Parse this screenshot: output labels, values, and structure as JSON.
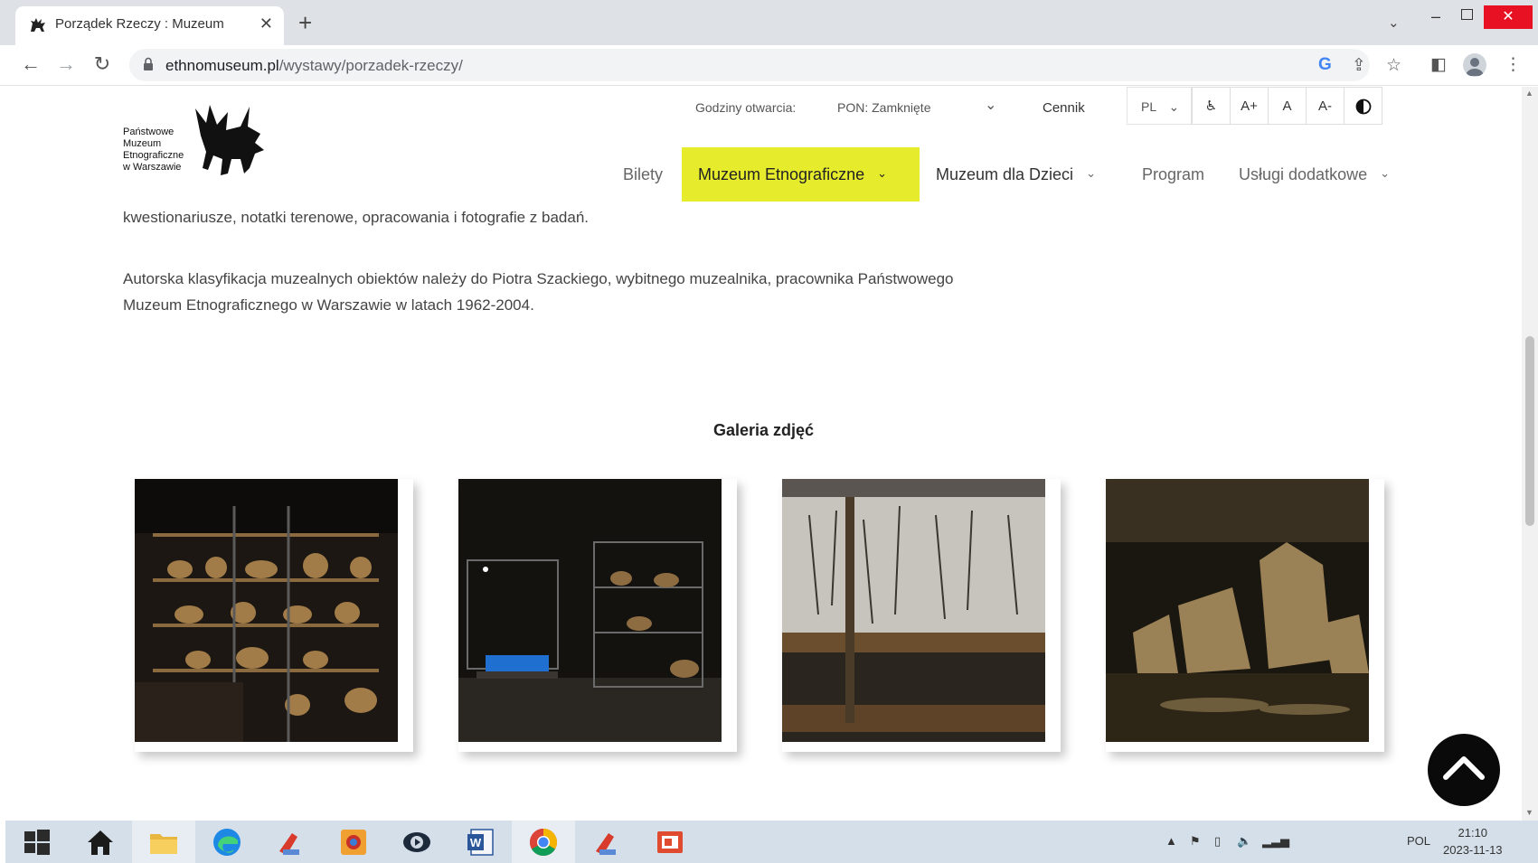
{
  "browser": {
    "tab_title": "Porządek Rzeczy : Muzeum",
    "tab_close": "✕",
    "new_tab": "+",
    "url_host": "ethnomuseum.pl",
    "url_path": "/wystawy/porzadek-rzeczy/"
  },
  "header": {
    "logo_text": [
      "Państwowe",
      "Muzeum",
      "Etnograficzne",
      "w Warszawie"
    ],
    "hours_label": "Godziny otwarcia:",
    "hours_value": "PON: Zamknięte",
    "pricing": "Cennik",
    "lang": "PL",
    "accessibility": {
      "font_increase": "A+",
      "font_normal": "A",
      "font_decrease": "A-"
    }
  },
  "nav": {
    "items": [
      {
        "label": "Bilety"
      },
      {
        "label": "Muzeum Etnograficzne"
      },
      {
        "label": "Muzeum dla Dzieci"
      },
      {
        "label": "Program"
      },
      {
        "label": "Usługi dodatkowe"
      }
    ],
    "accent_color": "#e6ec2c"
  },
  "content": {
    "para1": "kwestionariusze, notatki terenowe, opracowania i fotografie z badań.",
    "para2_line1": "Autorska klasyfikacja muzealnych obiektów należy do Piotra Szackiego, wybitnego muzealnika, pracownika Państwowego",
    "para2_line2": "Muzeum Etnograficznego w Warszawie w latach 1962-2004.",
    "gallery_title": "Galeria zdjęć"
  },
  "taskbar": {
    "language": "POL",
    "time": "21:10",
    "date": "2023-11-13"
  }
}
